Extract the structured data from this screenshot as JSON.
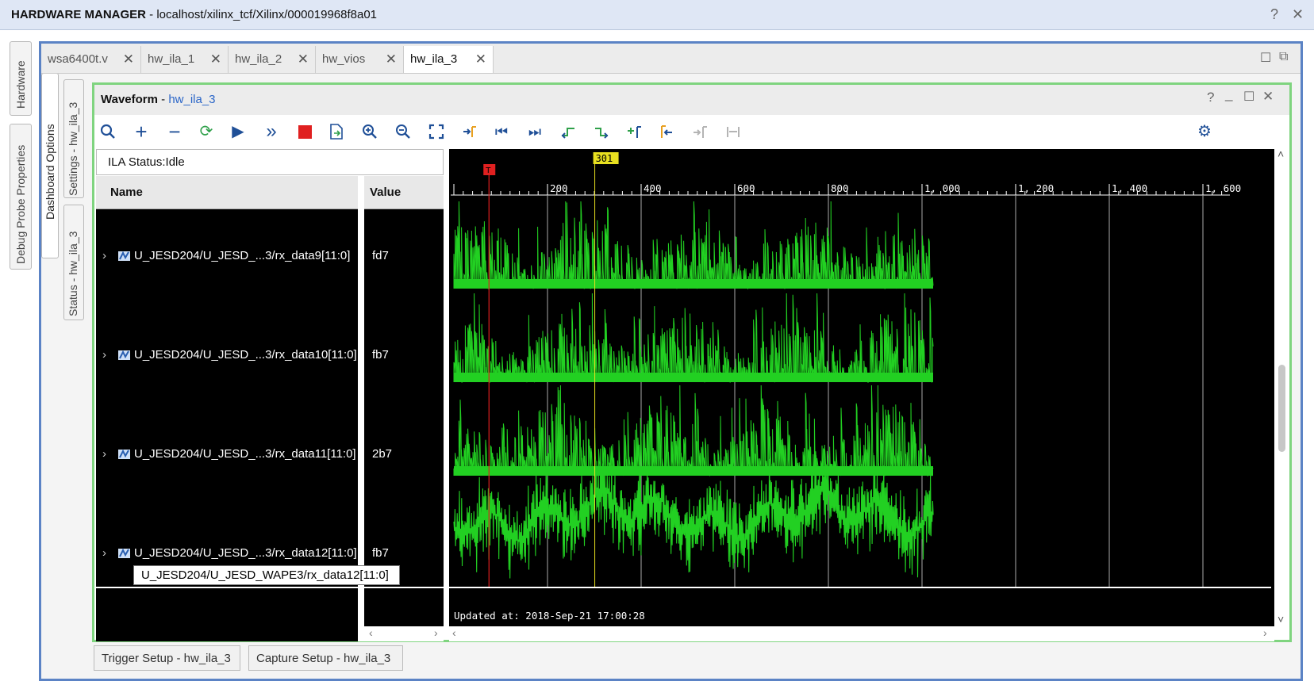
{
  "app": {
    "title_bold": "HARDWARE MANAGER",
    "title_path": " - localhost/xilinx_tcf/Xilinx/000019968f8a01",
    "help_icon": "help-icon",
    "close_icon": "close-icon"
  },
  "side_tabs": {
    "outer": [
      "Hardware",
      "Debug Probe Properties"
    ],
    "inner": [
      "Dashboard Options"
    ],
    "inner2": [
      "Settings - hw_ila_3",
      "Status - hw_ila_3"
    ]
  },
  "doc_tabs": [
    {
      "label": "wsa6400t.v",
      "active": false
    },
    {
      "label": "hw_ila_1",
      "active": false
    },
    {
      "label": "hw_ila_2",
      "active": false
    },
    {
      "label": "hw_vios",
      "active": false
    },
    {
      "label": "hw_ila_3",
      "active": true
    }
  ],
  "waveform": {
    "title": "Waveform",
    "title_sep": " - ",
    "title_link": "hw_ila_3",
    "ila_status": "ILA Status:Idle",
    "col_name": "Name",
    "col_value": "Value",
    "updated": "Updated at: 2018-Sep-21 17:00:28",
    "tooltip": "U_JESD204/U_JESD_WAPE3/rx_data12[11:0]",
    "toolbar_icons": [
      "search-icon",
      "add-icon",
      "remove-icon",
      "refresh-icon",
      "run-icon",
      "run-immediate-icon",
      "stop-icon",
      "export-icon",
      "zoom-in-icon",
      "zoom-out-icon",
      "zoom-fit-icon",
      "go-to-cursor-icon",
      "go-to-start-icon",
      "go-to-end-icon",
      "previous-transition-icon",
      "next-transition-icon",
      "add-marker-icon",
      "previous-marker-icon",
      "next-marker-icon",
      "swap-cursor-icon",
      "gear-icon"
    ],
    "signals": [
      {
        "name": "U_JESD204/U_JESD_...3/rx_data9[11:0]",
        "value": "fd7"
      },
      {
        "name": "U_JESD204/U_JESD_...3/rx_data10[11:0]",
        "value": "fb7"
      },
      {
        "name": "U_JESD204/U_JESD_...3/rx_data11[11:0]",
        "value": "2b7"
      },
      {
        "name": "U_JESD204/U_JESD_...3/rx_data12[11:0]",
        "value": "fb7"
      }
    ],
    "timeline": {
      "ticks": [
        "200",
        "400",
        "600",
        "800",
        "1, 000",
        "1, 200",
        "1, 400",
        "1, 600"
      ],
      "marker_label": "301",
      "trigger_label": "T",
      "accent_wave": "#22d022",
      "marker_color": "#e8e020",
      "trigger_color": "#e02020"
    }
  },
  "bottom_tabs": [
    "Trigger Setup - hw_ila_3",
    "Capture Setup - hw_ila_3"
  ]
}
